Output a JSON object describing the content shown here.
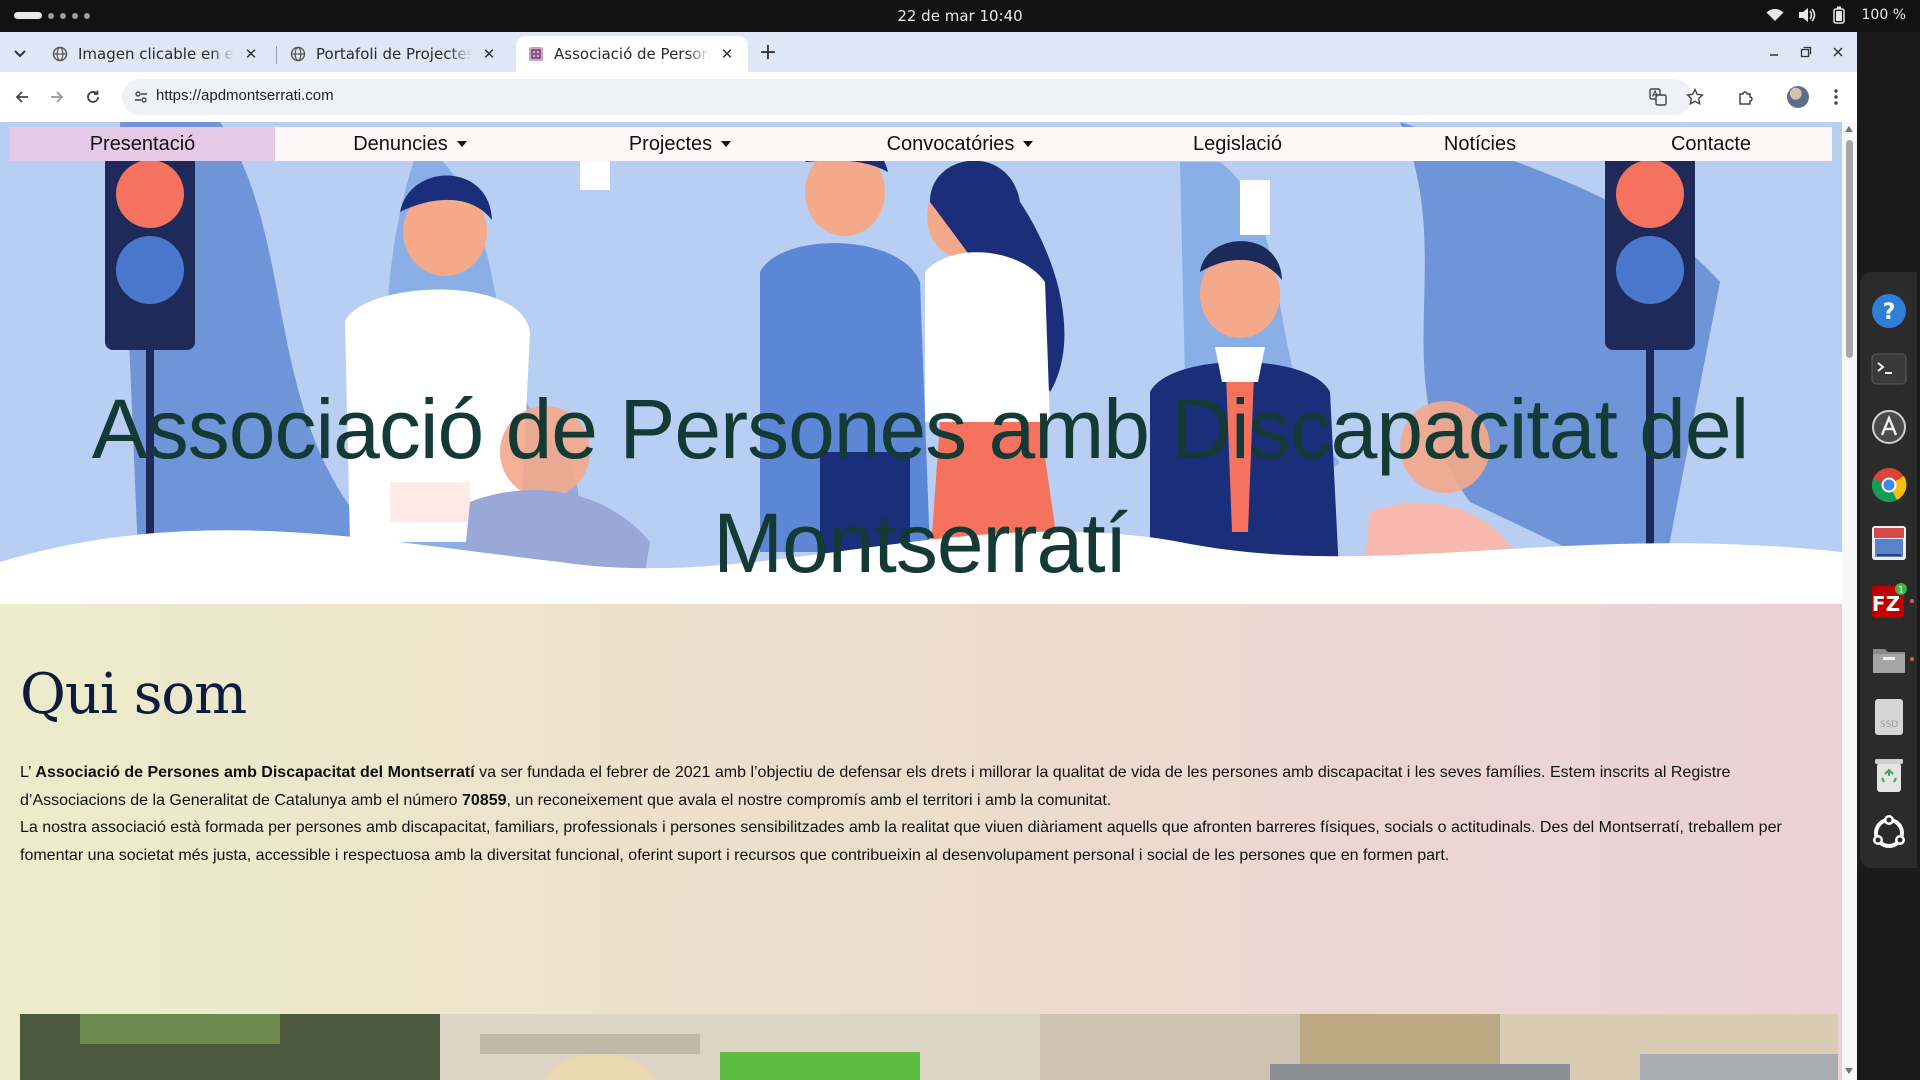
{
  "system": {
    "clock": "22 de mar  10:40",
    "battery": "100 %"
  },
  "browser": {
    "tabs": [
      {
        "title": "Imagen clicable en enlace"
      },
      {
        "title": "Portafoli de Projectes | Ju"
      },
      {
        "title": "Associació de Persones amb"
      }
    ],
    "url": "https://apdmontserrati.com"
  },
  "site": {
    "nav": [
      {
        "label": "Presentació",
        "dropdown": false
      },
      {
        "label": "Denuncies",
        "dropdown": true
      },
      {
        "label": "Projectes",
        "dropdown": true
      },
      {
        "label": "Convocatóries",
        "dropdown": true
      },
      {
        "label": "Legislació",
        "dropdown": false
      },
      {
        "label": "Notícies",
        "dropdown": false
      },
      {
        "label": "Contacte",
        "dropdown": false
      }
    ],
    "hero_title": "Associació de Persones amb Discapacitat del Montserratí",
    "about": {
      "heading": "Qui som",
      "p1_prefix": "L’ ",
      "p1_strong": "Associació de Persones amb Discapacitat del Montserratí",
      "p1_mid": " va ser fundada el febrer de 2021 amb l’objectiu de defensar els drets i millorar la qualitat de vida de les persones amb discapacitat i les seves famílies. Estem inscrits al Registre d’Associacions de la Generalitat de Catalunya amb el número ",
      "p1_number": "70859",
      "p1_suffix": ", un reconeixement que avala el nostre compromís amb el territori i amb la comunitat.",
      "p2": "La nostra associació està formada per persones amb discapacitat, familiars, professionals i persones sensibilitzades amb la realitat que viuen diàriament aquells que afronten barreres físiques, socials o actitudinals. Des del Montserratí, treballem per fomentar una societat més justa, accessible i respectuosa amb la diversitat funcional, oferint suport i recursos que contribueixin al desenvolupament personal i social de les persones que en formen part."
    }
  },
  "dock": {
    "items": [
      "help-icon",
      "terminal-icon",
      "software-updater-icon",
      "chrome-icon",
      "photo-app-icon",
      "filezilla-icon",
      "files-icon",
      "ssd-drive-icon",
      "trash-icon",
      "settings-app-icon"
    ],
    "filezilla_badge": "1",
    "ssd_label": "SSD"
  },
  "colors": {
    "nav_active_bg": "#e6c9e7",
    "hero_title": "#143a36",
    "heading": "#0f1b3d"
  }
}
